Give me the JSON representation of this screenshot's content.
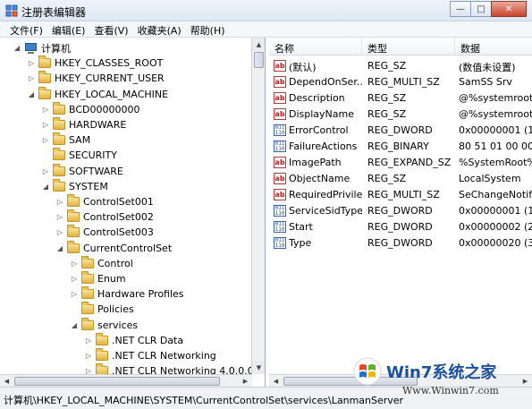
{
  "window": {
    "title": "注册表编辑器"
  },
  "menu": [
    "文件(F)",
    "编辑(E)",
    "查看(V)",
    "收藏夹(A)",
    "帮助(H)"
  ],
  "tree": [
    {
      "label": "计算机",
      "indent": 0,
      "expander": "expanded",
      "icon": "computer-icon"
    },
    {
      "label": "HKEY_CLASSES_ROOT",
      "indent": 1,
      "expander": "collapsed",
      "icon": "folder-icon"
    },
    {
      "label": "HKEY_CURRENT_USER",
      "indent": 1,
      "expander": "collapsed",
      "icon": "folder-icon"
    },
    {
      "label": "HKEY_LOCAL_MACHINE",
      "indent": 1,
      "expander": "expanded",
      "icon": "folder-icon"
    },
    {
      "label": "BCD00000000",
      "indent": 2,
      "expander": "collapsed",
      "icon": "folder-icon"
    },
    {
      "label": "HARDWARE",
      "indent": 2,
      "expander": "collapsed",
      "icon": "folder-icon"
    },
    {
      "label": "SAM",
      "indent": 2,
      "expander": "collapsed",
      "icon": "folder-icon"
    },
    {
      "label": "SECURITY",
      "indent": 2,
      "expander": "none",
      "icon": "folder-icon"
    },
    {
      "label": "SOFTWARE",
      "indent": 2,
      "expander": "collapsed",
      "icon": "folder-icon"
    },
    {
      "label": "SYSTEM",
      "indent": 2,
      "expander": "expanded",
      "icon": "folder-icon"
    },
    {
      "label": "ControlSet001",
      "indent": 3,
      "expander": "collapsed",
      "icon": "folder-icon"
    },
    {
      "label": "ControlSet002",
      "indent": 3,
      "expander": "collapsed",
      "icon": "folder-icon"
    },
    {
      "label": "ControlSet003",
      "indent": 3,
      "expander": "collapsed",
      "icon": "folder-icon"
    },
    {
      "label": "CurrentControlSet",
      "indent": 3,
      "expander": "expanded",
      "icon": "folder-icon"
    },
    {
      "label": "Control",
      "indent": 4,
      "expander": "collapsed",
      "icon": "folder-icon"
    },
    {
      "label": "Enum",
      "indent": 4,
      "expander": "collapsed",
      "icon": "folder-icon"
    },
    {
      "label": "Hardware Profiles",
      "indent": 4,
      "expander": "collapsed",
      "icon": "folder-icon"
    },
    {
      "label": "Policies",
      "indent": 4,
      "expander": "none",
      "icon": "folder-icon"
    },
    {
      "label": "services",
      "indent": 4,
      "expander": "expanded",
      "icon": "folder-icon"
    },
    {
      "label": ".NET CLR Data",
      "indent": 5,
      "expander": "collapsed",
      "icon": "folder-icon"
    },
    {
      "label": ".NET CLR Networking",
      "indent": 5,
      "expander": "collapsed",
      "icon": "folder-icon"
    },
    {
      "label": ".NET CLR Networking 4.0.0.0",
      "indent": 5,
      "expander": "collapsed",
      "icon": "folder-icon"
    }
  ],
  "list": {
    "headers": [
      "名称",
      "类型",
      "数据"
    ],
    "rows": [
      {
        "name": "(默认)",
        "type": "REG_SZ",
        "data": "(数值未设置)",
        "icon": "ab"
      },
      {
        "name": "DependOnSer...",
        "type": "REG_MULTI_SZ",
        "data": "SamSS Srv",
        "icon": "ab"
      },
      {
        "name": "Description",
        "type": "REG_SZ",
        "data": "@%systemroot",
        "icon": "ab"
      },
      {
        "name": "DisplayName",
        "type": "REG_SZ",
        "data": "@%systemroot",
        "icon": "ab"
      },
      {
        "name": "ErrorControl",
        "type": "REG_DWORD",
        "data": "0x00000001 (1)",
        "icon": "bin"
      },
      {
        "name": "FailureActions",
        "type": "REG_BINARY",
        "data": "80 51 01 00 00",
        "icon": "bin"
      },
      {
        "name": "ImagePath",
        "type": "REG_EXPAND_SZ",
        "data": "%SystemRoot%",
        "icon": "ab"
      },
      {
        "name": "ObjectName",
        "type": "REG_SZ",
        "data": "LocalSystem",
        "icon": "ab"
      },
      {
        "name": "RequiredPrivile...",
        "type": "REG_MULTI_SZ",
        "data": "SeChangeNotif",
        "icon": "ab"
      },
      {
        "name": "ServiceSidType",
        "type": "REG_DWORD",
        "data": "0x00000001 (1)",
        "icon": "bin"
      },
      {
        "name": "Start",
        "type": "REG_DWORD",
        "data": "0x00000002 (2)",
        "icon": "bin"
      },
      {
        "name": "Type",
        "type": "REG_DWORD",
        "data": "0x00000020 (32)",
        "icon": "bin"
      }
    ]
  },
  "status": {
    "path": "计算机\\HKEY_LOCAL_MACHINE\\SYSTEM\\CurrentControlSet\\services\\LanmanServer"
  },
  "watermark": {
    "text": "Win7系统之家",
    "url": "Www.Winwin7.com"
  },
  "colors": {
    "accent": "#1c4f9c",
    "folder": "#e2b540",
    "close": "#c8452d"
  }
}
